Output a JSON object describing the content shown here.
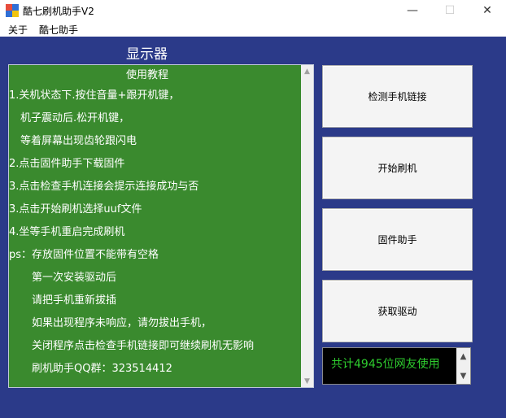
{
  "window": {
    "title": "酷七刷机助手V2",
    "minimize_glyph": "—",
    "maximize_glyph": "☐",
    "close_glyph": "✕"
  },
  "menu": {
    "items": [
      "关于",
      "酷七助手"
    ]
  },
  "display_label": "显示器",
  "tutorial": {
    "title": "使用教程",
    "lines": [
      "1.关机状态下.按住音量+跟开机键，",
      "  机子震动后.松开机键，",
      "  等着屏幕出现齿轮跟闪电",
      "2.点击固件助手下载固件",
      "3.点击检查手机连接会提示连接成功与否",
      "3.点击开始刷机选择uuf文件",
      "4.坐等手机重启完成刷机",
      "ps：存放固件位置不能带有空格",
      "    第一次安装驱动后",
      "    请把手机重新拔插",
      "    如果出现程序未响应，请勿拔出手机，",
      "    关闭程序点击检查手机链接即可继续刷机无影响",
      "    刷机助手QQ群：323514412"
    ]
  },
  "buttons": {
    "detect": "检测手机链接",
    "start": "开始刷机",
    "firmware": "固件助手",
    "driver": "获取驱动"
  },
  "counter": {
    "text": "共计4945位网友使用"
  },
  "scroll": {
    "up_glyph": "▲",
    "down_glyph": "▼"
  },
  "colors": {
    "client_bg": "#2b3a89",
    "tutorial_bg": "#3a8a2e",
    "counter_text": "#2ecc2e"
  }
}
